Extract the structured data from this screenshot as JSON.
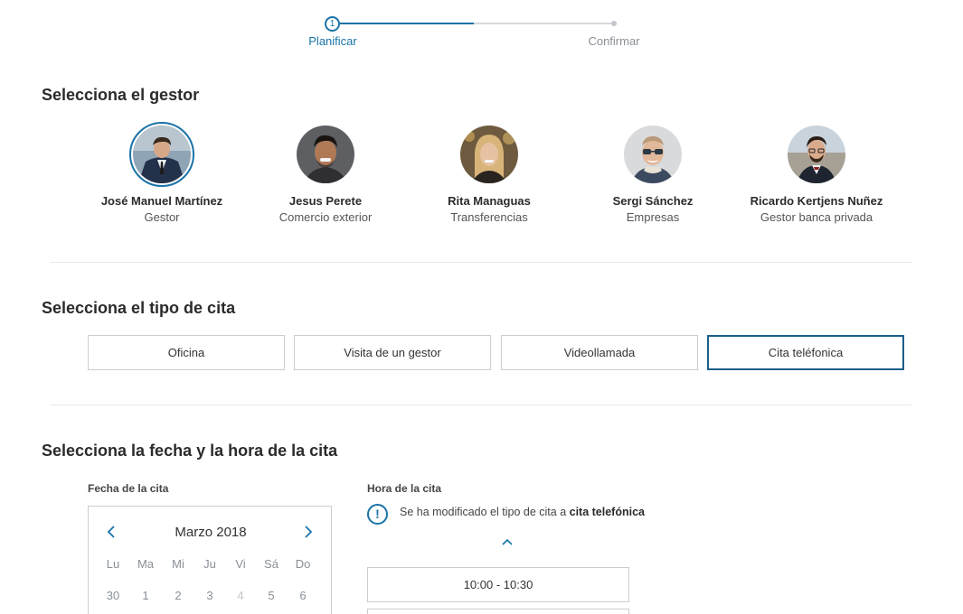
{
  "stepper": {
    "current_step": "1",
    "steps": [
      "Planificar",
      "Confirmar"
    ]
  },
  "managers_section": {
    "title": "Selecciona el gestor",
    "managers": [
      {
        "name": "José Manuel Martínez",
        "role": "Gestor",
        "selected": true
      },
      {
        "name": "Jesus Perete",
        "role": "Comercio exterior",
        "selected": false
      },
      {
        "name": "Rita Managuas",
        "role": "Transferencias",
        "selected": false
      },
      {
        "name": "Sergi Sánchez",
        "role": "Empresas",
        "selected": false
      },
      {
        "name": "Ricardo Kertjens Nuñez",
        "role": "Gestor banca privada",
        "selected": false
      }
    ]
  },
  "type_section": {
    "title": "Selecciona el tipo de cita",
    "options": [
      "Oficina",
      "Visita de un gestor",
      "Videollamada",
      "Cita teléfonica"
    ],
    "selected": "Cita teléfonica"
  },
  "datetime_section": {
    "title": "Selecciona la fecha y la hora de la cita",
    "date_label": "Fecha de la cita",
    "time_label": "Hora de la cita",
    "calendar": {
      "month": "Marzo 2018",
      "weekdays": [
        "Lu",
        "Ma",
        "Mi",
        "Ju",
        "Vi",
        "Sá",
        "Do"
      ],
      "first_row": [
        "30",
        "1",
        "2",
        "3",
        "4",
        "5",
        "6"
      ]
    },
    "notice_prefix": "Se ha modificado el tipo de cita a ",
    "notice_bold": "cita telefónica",
    "slots": [
      "10:00 - 10:30",
      ""
    ]
  },
  "colors": {
    "accent": "#1a73a8",
    "border": "#c9cdd1",
    "divider": "#e6e8ea"
  }
}
